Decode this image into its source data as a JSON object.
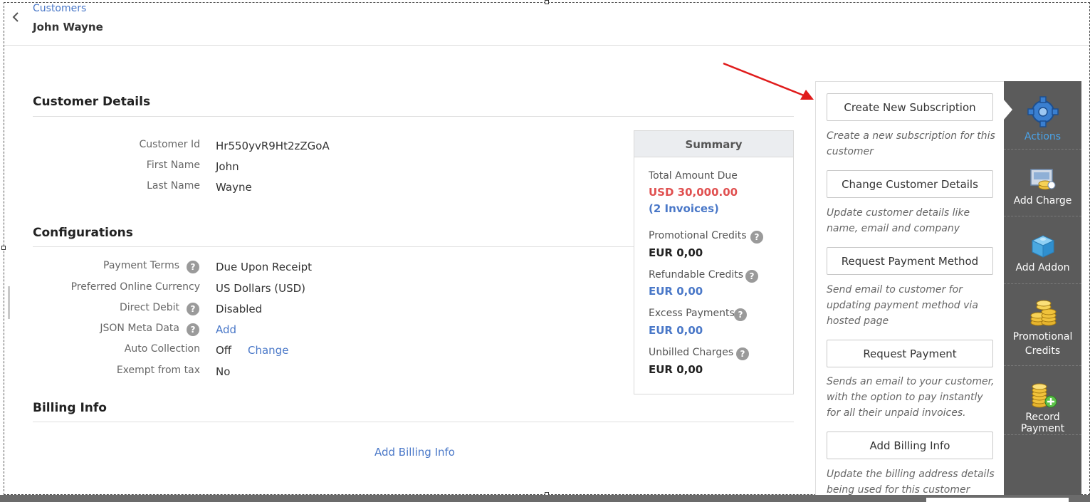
{
  "header": {
    "breadcrumb": "Customers",
    "title": "John Wayne"
  },
  "customer_details": {
    "title": "Customer Details",
    "fields": [
      {
        "label": "Customer Id",
        "value": "Hr550yvR9Ht2zZGoA"
      },
      {
        "label": "First Name",
        "value": "John"
      },
      {
        "label": "Last Name",
        "value": "Wayne"
      }
    ]
  },
  "configurations": {
    "title": "Configurations",
    "payment_terms": {
      "label": "Payment Terms",
      "value": "Due Upon Receipt"
    },
    "currency": {
      "label": "Preferred Online Currency",
      "value": "US Dollars (USD)"
    },
    "direct_debit": {
      "label": "Direct Debit",
      "value": "Disabled"
    },
    "json_meta": {
      "label": "JSON Meta Data",
      "value": "Add"
    },
    "auto_collection": {
      "label": "Auto Collection",
      "value": "Off",
      "action": "Change"
    },
    "exempt_tax": {
      "label": "Exempt from tax",
      "value": "No"
    }
  },
  "billing_info": {
    "title": "Billing Info",
    "add_link": "Add Billing Info"
  },
  "summary": {
    "title": "Summary",
    "total_due_label": "Total Amount Due",
    "total_due_value": "USD 30,000.00",
    "invoices_link": "(2 Invoices)",
    "promo_label": "Promotional Credits",
    "promo_value": "EUR 0,00",
    "refund_label": "Refundable Credits",
    "refund_value": "EUR 0,00",
    "excess_label": "Excess Payments",
    "excess_value": "EUR 0,00",
    "unbilled_label": "Unbilled Charges",
    "unbilled_value": "EUR 0,00"
  },
  "actions": [
    {
      "label": "Create New Subscription",
      "desc": "Create a new subscription for this customer"
    },
    {
      "label": "Change Customer Details",
      "desc": "Update customer details like name, email and company"
    },
    {
      "label": "Request Payment Method",
      "desc": "Send email to customer for updating payment method via hosted page"
    },
    {
      "label": "Request Payment",
      "desc": "Sends an email to your customer, with the option to pay instantly for all their unpaid invoices."
    },
    {
      "label": "Add Billing Info",
      "desc": "Update the billing address details being used for this customer"
    }
  ],
  "side_nav": {
    "actions": "Actions",
    "add_charge": "Add Charge",
    "add_addon": "Add Addon",
    "promotional_credits": "Promotional Credits",
    "record_payment": "Record Payment"
  },
  "colors": {
    "link": "#4a78c8",
    "amount_due": "#e05050",
    "sidebar": "#5b5b5b",
    "arrow": "#e01b1b"
  },
  "icons": {
    "back": "chevron-left-icon",
    "help": "question-circle-icon",
    "actions": "gear-icon",
    "add_charge": "charge-icon",
    "add_addon": "cube-icon",
    "promotional_credits": "coins-icon",
    "record_payment": "coins-plus-icon"
  }
}
